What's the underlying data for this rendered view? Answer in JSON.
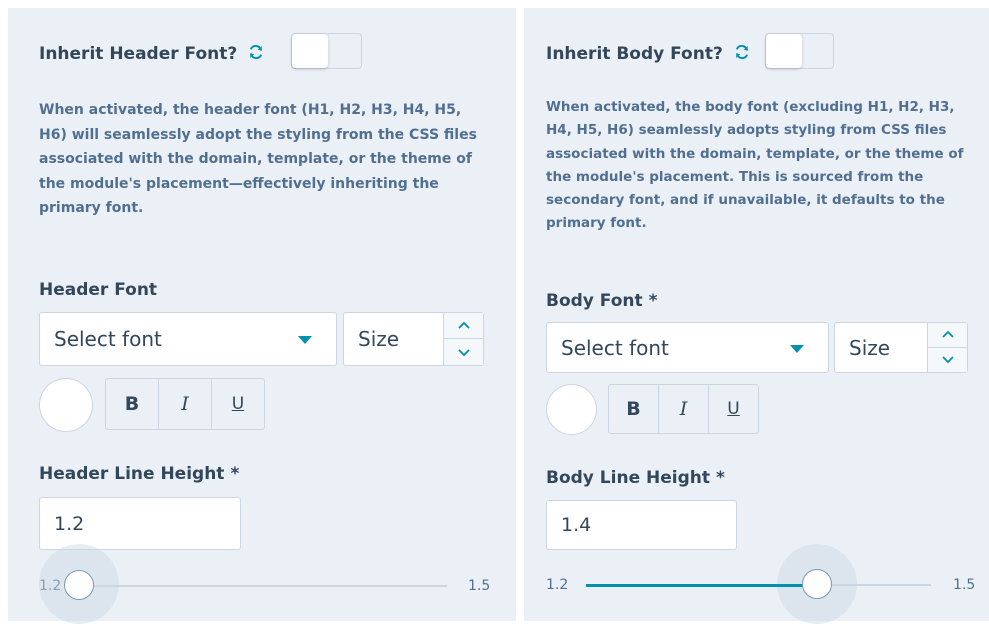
{
  "left": {
    "toggle_label": "Inherit Header Font?",
    "toggle_on": false,
    "description": "When activated, the header font (H1, H2, H3, H4, H5, H6) will seamlessly adopt the styling from the CSS files associated with the domain, template, or the theme of the module's placement—effectively inheriting the primary font.",
    "font_label": "Header Font",
    "font_select": "Select font",
    "size_placeholder": "Size",
    "format_bold": "B",
    "format_italic": "I",
    "format_underline": "U",
    "line_height_label": "Header Line Height",
    "required_mark": "*",
    "line_height_value": "1.2",
    "slider_min": "1.2",
    "slider_max": "1.5",
    "slider_value": 1.2
  },
  "right": {
    "toggle_label": "Inherit Body Font?",
    "toggle_on": false,
    "description": "When activated, the body font (excluding H1, H2, H3, H4, H5, H6) seamlessly adopts styling from CSS files associated with the domain, template, or the theme of the module's placement. This is sourced from the secondary font, and if unavailable, it defaults to the primary font.",
    "font_label": "Body Font",
    "required_mark": "*",
    "font_select": "Select font",
    "size_placeholder": "Size",
    "format_bold": "B",
    "format_italic": "I",
    "format_underline": "U",
    "line_height_label": "Body Line Height",
    "line_height_value": "1.4",
    "slider_min": "1.2",
    "slider_max": "1.5",
    "slider_value": 1.4
  },
  "colors": {
    "accent": "#0091ae",
    "panel_bg": "#eaf0f6",
    "text": "#33475b",
    "muted_text": "#516f90",
    "border": "#cbd6e2"
  },
  "icons": {
    "refresh": "refresh-icon",
    "caret": "caret-down-icon",
    "step_up": "chevron-up-icon",
    "step_down": "chevron-down-icon"
  }
}
